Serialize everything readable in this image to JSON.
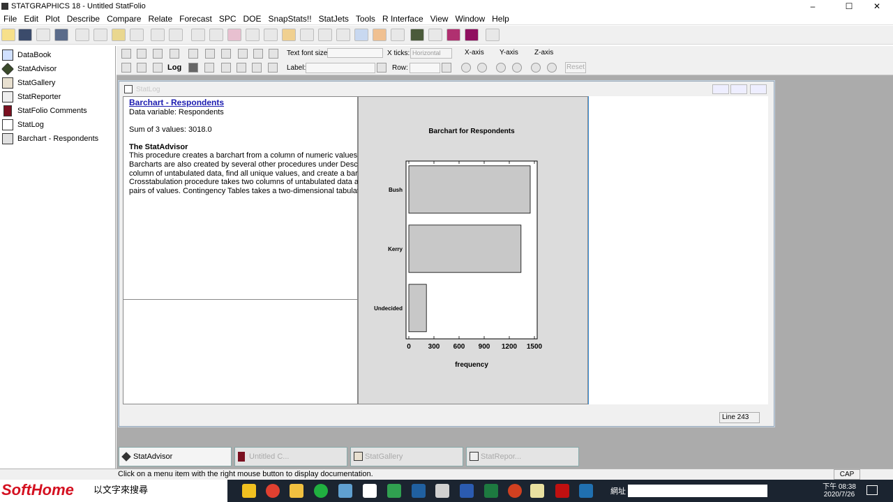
{
  "app": {
    "title": "STATGRAPHICS 18 - Untitled StatFolio",
    "window_controls": {
      "minimize": "–",
      "maximize": "☐",
      "close": "✕"
    }
  },
  "menu": [
    "File",
    "Edit",
    "Plot",
    "Describe",
    "Compare",
    "Relate",
    "Forecast",
    "SPC",
    "DOE",
    "SnapStats!!",
    "StatJets",
    "Tools",
    "R Interface",
    "View",
    "Window",
    "Help"
  ],
  "sidebar": {
    "items": [
      {
        "label": "DataBook"
      },
      {
        "label": "StatAdvisor"
      },
      {
        "label": "StatGallery"
      },
      {
        "label": "StatReporter"
      },
      {
        "label": "StatFolio Comments"
      },
      {
        "label": "StatLog"
      },
      {
        "label": "Barchart - Respondents"
      }
    ]
  },
  "toolbar2": {
    "text_font_size_label": "Text font size:",
    "x_ticks_label": "X ticks:",
    "x_ticks_value": "Horizontal",
    "xaxis": "X-axis",
    "yaxis": "Y-axis",
    "zaxis": "Z-axis",
    "label_label": "Label:",
    "row_label": "Row:",
    "reset": "Reset"
  },
  "statlog": {
    "title": "StatLog",
    "line_indicator": "Line 243"
  },
  "report": {
    "heading": "Barchart - Respondents",
    "data_variable": "Data variable: Respondents",
    "sum_line": "Sum of 3 values: 3018.0",
    "advisor_title": "The StatAdvisor",
    "advisor_lines": [
      "This procedure creates a barchart from a column of numeric values.  A",
      "Barcharts are also created by several other procedures under Describe",
      "column of untabulated data, find all unique values, and create a barcha",
      "Crosstabulation procedure takes two columns of untabulated data and",
      "pairs of values.  Contingency Tables takes a two-dimensional tabulatio"
    ]
  },
  "chart_data": {
    "type": "bar",
    "orientation": "horizontal",
    "title": "Barchart for Respondents",
    "xlabel": "frequency",
    "categories": [
      "Bush",
      "Kerry",
      "Undecided"
    ],
    "values": [
      1450,
      1340,
      210
    ],
    "xlim": [
      0,
      1500
    ],
    "xticks": [
      0,
      300,
      600,
      900,
      1200,
      1500
    ],
    "bar_color": "#c8c8c8"
  },
  "tabs": [
    {
      "label": "StatAdvisor"
    },
    {
      "label": "Untitled C..."
    },
    {
      "label": "StatGallery"
    },
    {
      "label": "StatRepor..."
    }
  ],
  "status": {
    "message": "Click on a menu item with the right mouse button to display documentation.",
    "cap": "CAP"
  },
  "taskbar": {
    "brand": "SoftHome",
    "search_text": "以文字來搜尋",
    "address_label": "網址",
    "time": "下午 08:38",
    "date": "2020/7/26"
  }
}
